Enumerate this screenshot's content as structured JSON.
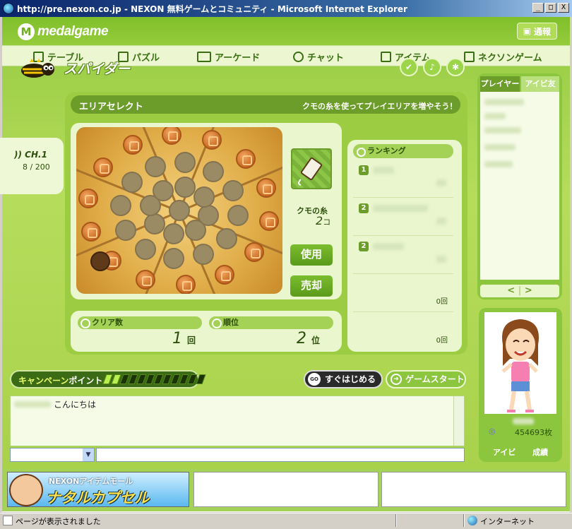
{
  "window": {
    "title": "http://pre.nexon.co.jp - NEXON 無料ゲームとコミュニティ - Microsoft Internet Explorer",
    "buttons": [
      "_",
      "□",
      "X"
    ]
  },
  "site": {
    "logo_letter": "M",
    "logo": "medalgame",
    "notify_label": "通報"
  },
  "nav": {
    "items": [
      {
        "label": "テーブル",
        "icon": "table-icon"
      },
      {
        "label": "パズル",
        "icon": "puzzle-icon"
      },
      {
        "label": "アーケード",
        "icon": "arcade-icon"
      },
      {
        "label": "チャット",
        "icon": "chat-icon"
      },
      {
        "label": "アイテム",
        "icon": "cart-icon"
      },
      {
        "label": "ネクソンゲーム",
        "icon": "nexon-icon"
      }
    ]
  },
  "game": {
    "title": "スパイダー",
    "header_buttons": [
      "badge-icon",
      "sound-icon",
      "settings-icon"
    ],
    "channel": {
      "label": "CH.1",
      "count": "8 / 200"
    },
    "area_title": "エリアセレクト",
    "area_hint": "クモの糸を使ってプレイエリアを増やそう！",
    "item": {
      "label": "クモの糸",
      "count": "2",
      "unit": "コ"
    },
    "use_button": "使用",
    "sell_button": "売却",
    "stats": {
      "clear_label": "クリア数",
      "clear_value": "1",
      "clear_unit": "回",
      "rank_label": "順位",
      "rank_value": "2",
      "rank_unit": "位"
    },
    "ranking": {
      "title": "ランキング",
      "rows": [
        {
          "badge": "1",
          "score": "0回"
        },
        {
          "badge": "2",
          "score": "0回"
        },
        {
          "badge": "2",
          "score": "0回"
        },
        {
          "badge": "",
          "score": "0回"
        },
        {
          "badge": "",
          "score": "0回"
        }
      ]
    },
    "campaign": {
      "label_a": "キャンペーン",
      "label_b": "ポイント",
      "level": 0.17
    },
    "quick_start": "すぐはじめる",
    "quick_icon": "GO",
    "game_start": "ゲームスタート"
  },
  "sidebar": {
    "tabs": [
      "プレイヤー",
      "アイビ友"
    ],
    "pager_prev": "<",
    "pager_next": ">",
    "money": "454693枚",
    "links": [
      "アイビ",
      "成績"
    ]
  },
  "chat": {
    "message": "こんにちは"
  },
  "ads": {
    "top": "NEXONアイテムモール",
    "main": "ナタルカプセル"
  },
  "status": {
    "left": "ページが表示されました",
    "zone": "インターネット"
  }
}
